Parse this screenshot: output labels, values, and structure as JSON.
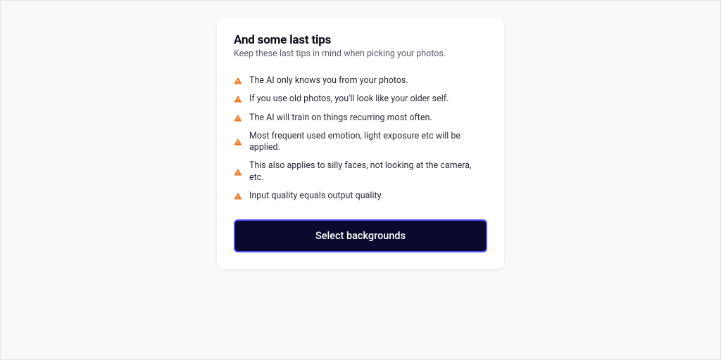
{
  "card": {
    "title": "And some last tips",
    "subtitle": "Keep these last tips in mind when picking your photos.",
    "tips": [
      "The AI only knows you from your photos.",
      "If you use old photos, you'll look like your older self.",
      "The AI will train on things recurring most often.",
      "Most frequent used emotion, light exposure etc will be applied.",
      "This also applies to silly faces, not looking at the camera, etc.",
      "Input quality equals output quality."
    ],
    "cta_label": "Select backgrounds"
  },
  "colors": {
    "warning_icon": "#f97316"
  }
}
